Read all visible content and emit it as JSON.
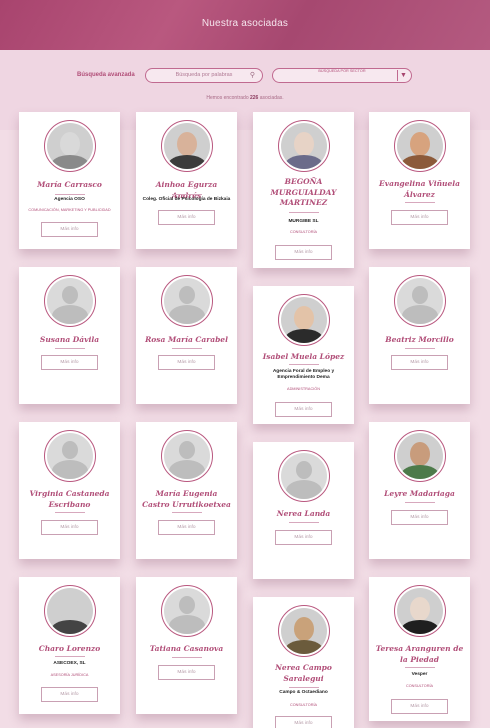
{
  "header": {
    "title": "Nuestra asociadas"
  },
  "search": {
    "label": "Búsqueda avanzada",
    "words_placeholder": "Búsqueda por palabras",
    "sector_placeholder": "Búsqueda por sector",
    "results_prefix": "Hemos encontrado",
    "results_count": "226",
    "results_suffix": "asociadas."
  },
  "more_label": "Más info",
  "members": [
    {
      "name": "María Carrasco",
      "company": "Agencia OSO",
      "sector": "COMUNICACIÓN, MARKETING Y PUBLICIDAD",
      "avatar": "photo"
    },
    {
      "name": "Ainhoa Egurza Andrés",
      "company": "Coleg. Oficial de Psicología de Bizkaia",
      "sector": "",
      "avatar": "photo"
    },
    {
      "name": "BEGOÑA MURGUIALDAY MARTINEZ",
      "company": "MURGIBE SL",
      "sector": "CONSULTORÍA",
      "avatar": "photo"
    },
    {
      "name": "Evangelina Viñuela Álvarez",
      "company": "",
      "sector": "",
      "avatar": "photo"
    },
    {
      "name": "Susana Dávila",
      "company": "",
      "sector": "",
      "avatar": "silhouette"
    },
    {
      "name": "Rosa María Carabel",
      "company": "",
      "sector": "",
      "avatar": "silhouette"
    },
    {
      "name": "Isabel Muela López",
      "company": "Agencia Foral de Empleo y Emprendimiento Dema",
      "sector": "ADMINISTRACIÓN",
      "avatar": "photo"
    },
    {
      "name": "Beatriz Morcillo",
      "company": "",
      "sector": "",
      "avatar": "silhouette"
    },
    {
      "name": "Virginia Castaneda Escribano",
      "company": "",
      "sector": "",
      "avatar": "silhouette"
    },
    {
      "name": "María Eugenia Castro Urrutikoetxea",
      "company": "",
      "sector": "",
      "avatar": "silhouette"
    },
    {
      "name": "Nerea Landa",
      "company": "",
      "sector": "",
      "avatar": "silhouette"
    },
    {
      "name": "Leyre Madariaga",
      "company": "",
      "sector": "",
      "avatar": "photo"
    },
    {
      "name": "Charo Lorenzo",
      "company": "ASECOEX, SL",
      "sector": "ASESORÍA JURÍDICA",
      "avatar": "photo"
    },
    {
      "name": "Tatiana Casanova",
      "company": "",
      "sector": "",
      "avatar": "silhouette"
    },
    {
      "name": "Nerea Campo Saralegui",
      "company": "Campo & Octaediano",
      "sector": "CONSULTORÍA",
      "avatar": "photo"
    },
    {
      "name": "Teresa Aranguren de la Piedad",
      "company": "Vesper",
      "sector": "CONSULTORÍA",
      "avatar": "photo"
    }
  ]
}
